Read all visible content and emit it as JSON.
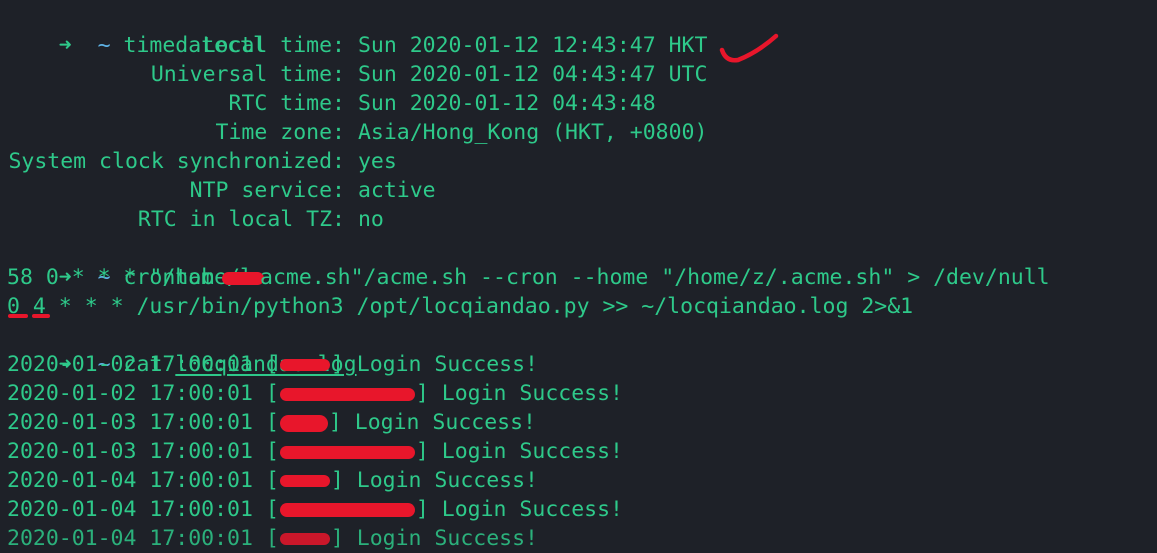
{
  "colors": {
    "background": "#1e2128",
    "text": "#2ec98a",
    "prompt_tilde": "#5fb3e6",
    "annotation": "#e8162b"
  },
  "prompt": {
    "arrow": "➜",
    "dir": "~"
  },
  "commands": {
    "timedatectl": "timedatectl",
    "crontab": "crontab -l",
    "cat": "cat",
    "cat_arg": "locqiandao.log"
  },
  "timedatectl": [
    {
      "label": "Local time:",
      "value": "Sun 2020-01-12 12:43:47 HKT"
    },
    {
      "label": "Universal time:",
      "value": "Sun 2020-01-12 04:43:47 UTC"
    },
    {
      "label": "RTC time:",
      "value": "Sun 2020-01-12 04:43:48"
    },
    {
      "label": "Time zone:",
      "value": "Asia/Hong_Kong (HKT, +0800)"
    },
    {
      "label": "System clock synchronized:",
      "value": "yes"
    },
    {
      "label": "NTP service:",
      "value": "active"
    },
    {
      "label": "RTC in local TZ:",
      "value": "no"
    }
  ],
  "crontab": {
    "line1_a": "58 0 * * * \"/home/",
    "line1_b": "acme.sh\"/acme.sh --cron --home \"/home/z/.acme.sh\" > /dev/null",
    "line2_min": "0",
    "line2_hour": "4",
    "line2_rest": " * * * /usr/bin/python3 /opt/locqiandao.py >> ~/locqiandao.log 2>&1"
  },
  "log_entries": [
    {
      "timestamp": "2020-01-02 17:00:01",
      "open": "[",
      "close": "]",
      "message": "Login Success!"
    },
    {
      "timestamp": "2020-01-02 17:00:01",
      "open": "[",
      "close": "]",
      "message": "Login Success!"
    },
    {
      "timestamp": "2020-01-03 17:00:01",
      "open": "[",
      "close": "]",
      "message": "Login Success!"
    },
    {
      "timestamp": "2020-01-03 17:00:01",
      "open": "[",
      "close": "]",
      "message": "Login Success!"
    },
    {
      "timestamp": "2020-01-04 17:00:01",
      "open": "[",
      "close": "]",
      "message": "Login Success!"
    },
    {
      "timestamp": "2020-01-04 17:00:01",
      "open": "[",
      "close": "]",
      "message": "Login Success!"
    }
  ]
}
